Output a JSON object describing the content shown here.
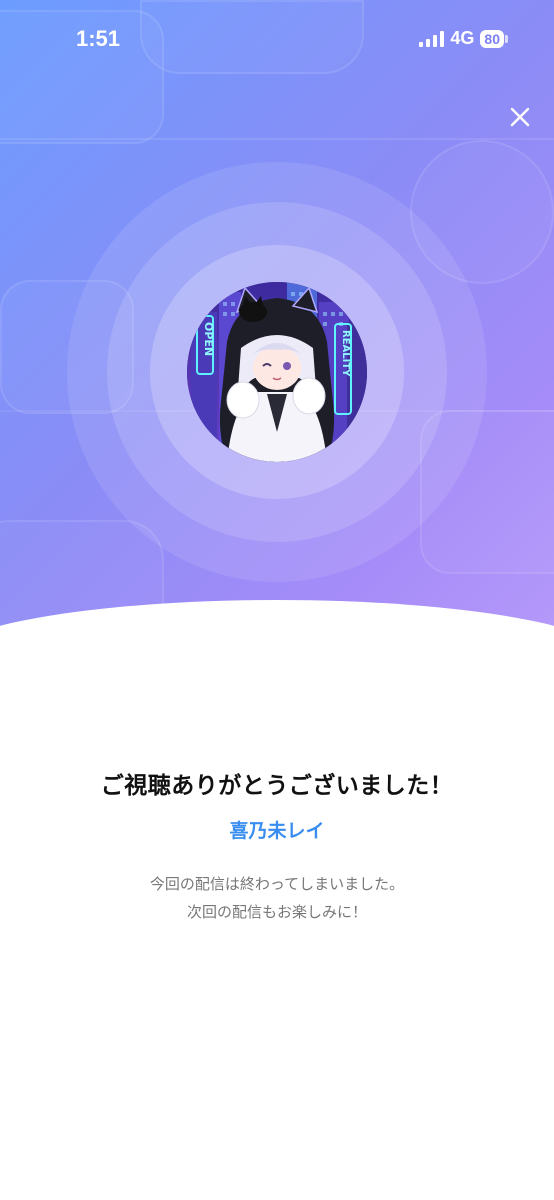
{
  "status_bar": {
    "time": "1:51",
    "network": "4G",
    "battery": "80"
  },
  "header": {
    "close_icon": "close-icon"
  },
  "colors": {
    "gradient_start": "#6c9cff",
    "gradient_end": "#b99cfa",
    "streamer_name": "#3a8df0"
  },
  "main": {
    "thanks_message": "ご視聴ありがとうございました！",
    "streamer_name": "喜乃未レイ",
    "ended_line1": "今回の配信は終わってしまいました。",
    "ended_line2": "次回の配信もお楽しみに！"
  },
  "avatar": {
    "sign_left": "OPEN",
    "sign_right": "REALITY"
  }
}
